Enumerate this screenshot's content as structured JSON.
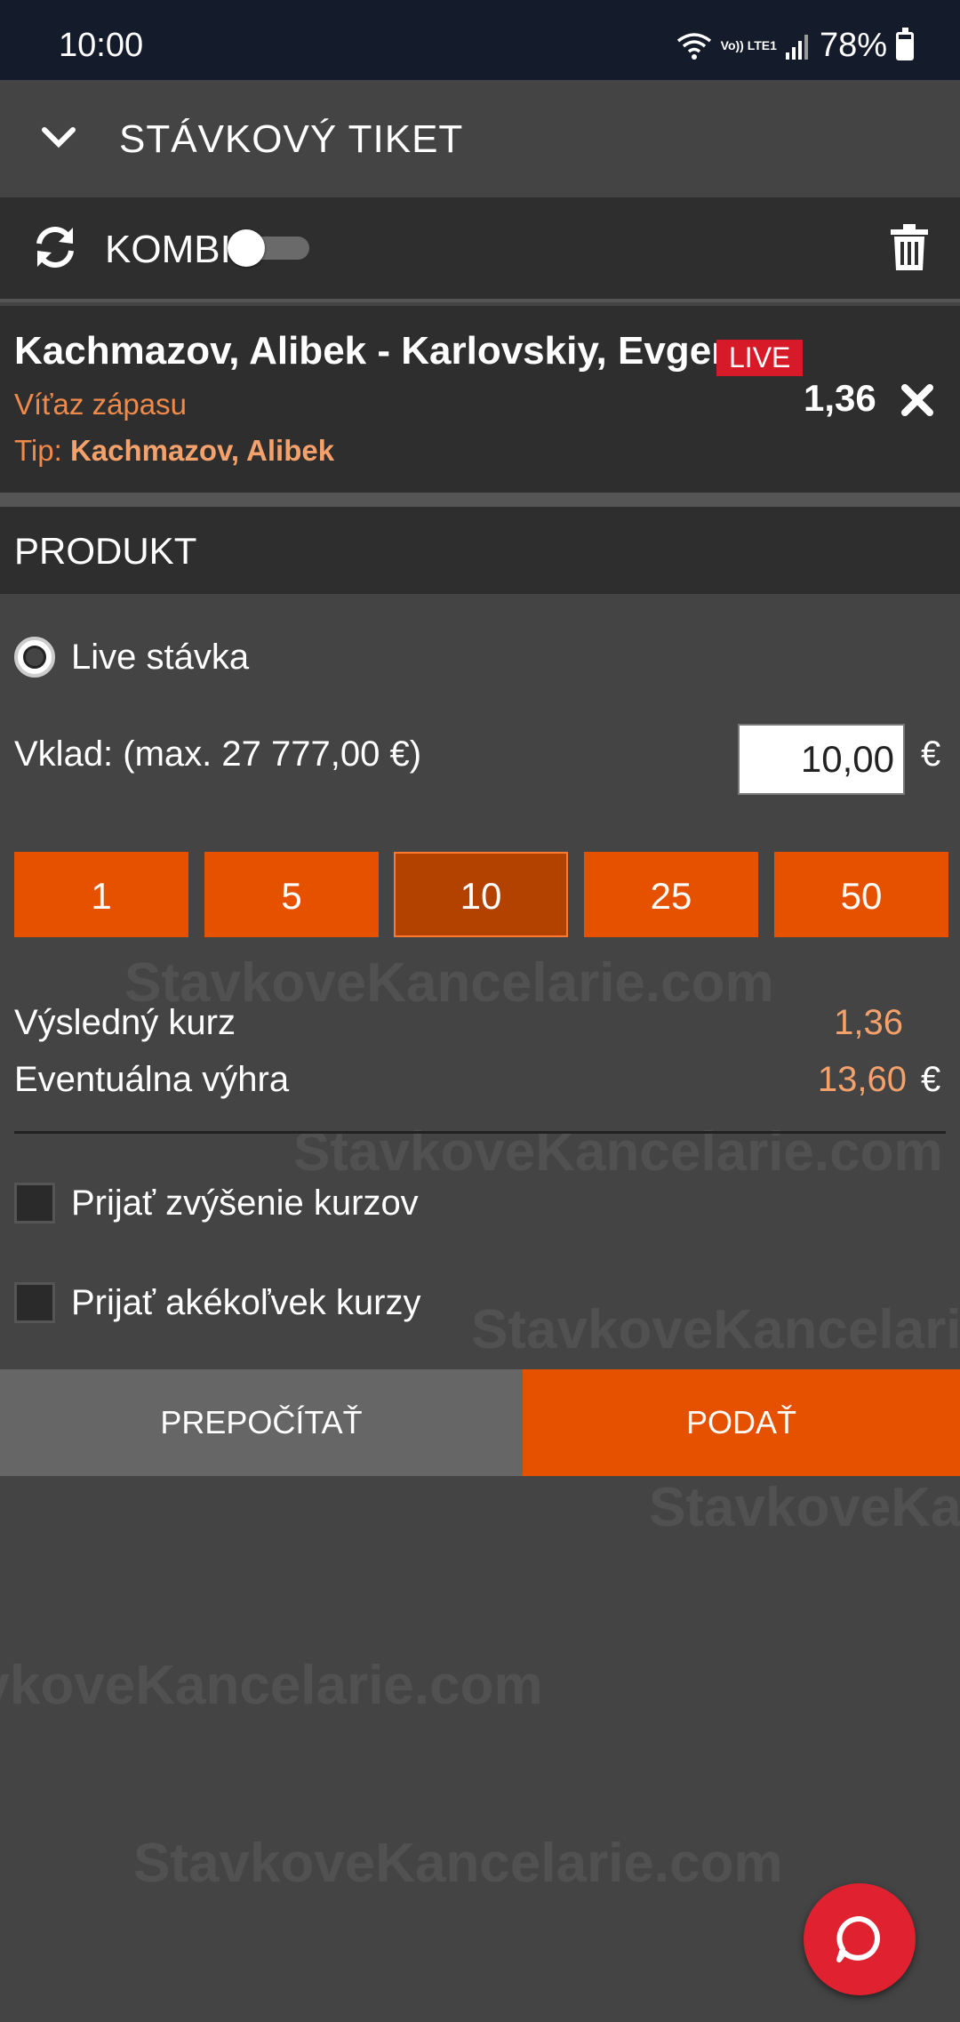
{
  "status_bar": {
    "time": "10:00",
    "network": "Vo)) LTE1",
    "battery": "78%",
    "battery_level": 0.78
  },
  "header": {
    "title": "STÁVKOVÝ TIKET"
  },
  "kombi": {
    "label": "KOMBI",
    "enabled": false
  },
  "bet": {
    "match": "Kachmazov, Alibek - Karlovskiy, Evgeny",
    "live_badge": "LIVE",
    "market": "Víťaz zápasu",
    "tip_label": "Tip:",
    "tip_value": "Kachmazov, Alibek",
    "odds": "1,36"
  },
  "produkt": {
    "title": "PRODUKT",
    "option": "Live stávka"
  },
  "stake": {
    "label": "Vklad: (max. 27 777,00 €)",
    "value": "10,00",
    "currency": "€",
    "quick_amounts": [
      "1",
      "5",
      "10",
      "25",
      "50"
    ],
    "selected_quick": "10"
  },
  "summary": {
    "odds_label": "Výsledný kurz",
    "odds_value": "1,36",
    "win_label": "Eventuálna výhra",
    "win_value": "13,60",
    "currency": "€"
  },
  "options": {
    "accept_increase": "Prijať zvýšenie kurzov",
    "accept_any": "Prijať akékoľvek kurzy"
  },
  "actions": {
    "recalculate": "PREPOČÍTAŤ",
    "submit": "PODAŤ"
  },
  "watermark": "StavkoveKancelarie.com",
  "colors": {
    "accent": "#e65100",
    "live": "#d71a28",
    "highlight_text": "#f4a16b",
    "chat": "#e0212f"
  }
}
